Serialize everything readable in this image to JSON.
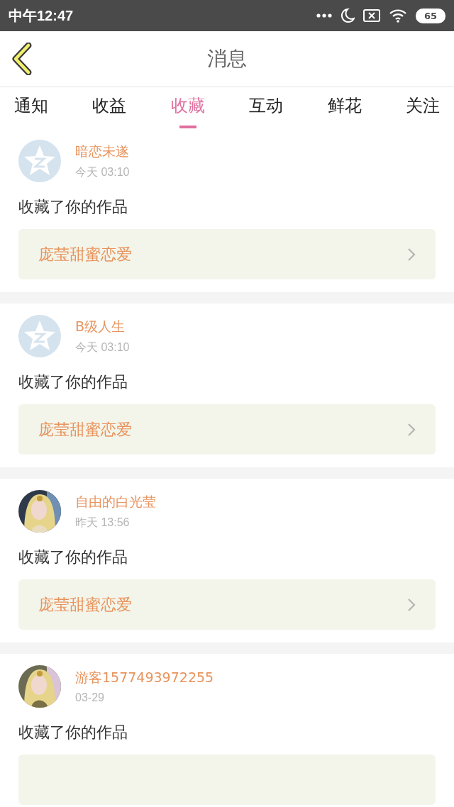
{
  "status_bar": {
    "time": "中午12:47",
    "battery": "65"
  },
  "header": {
    "title": "消息"
  },
  "tabs": [
    {
      "label": "通知",
      "selected": false
    },
    {
      "label": "收益",
      "selected": false
    },
    {
      "label": "收藏",
      "selected": true
    },
    {
      "label": "互动",
      "selected": false
    },
    {
      "label": "鲜花",
      "selected": false
    },
    {
      "label": "关注",
      "selected": false
    }
  ],
  "messages": [
    {
      "kind": "default",
      "name": "暗恋未遂",
      "time": "今天 03:10",
      "text": "收藏了你的作品",
      "work": "庞莹甜蜜恋爱"
    },
    {
      "kind": "default",
      "name": "B级人生",
      "time": "今天 03:10",
      "text": "收藏了你的作品",
      "work": "庞莹甜蜜恋爱"
    },
    {
      "kind": "picture",
      "name": "自由的白光莹",
      "time": "昨天 13:56",
      "text": "收藏了你的作品",
      "work": "庞莹甜蜜恋爱"
    },
    {
      "kind": "picture",
      "name": "游客1577493972255",
      "time": "03-29",
      "text": "收藏了你的作品"
    }
  ]
}
